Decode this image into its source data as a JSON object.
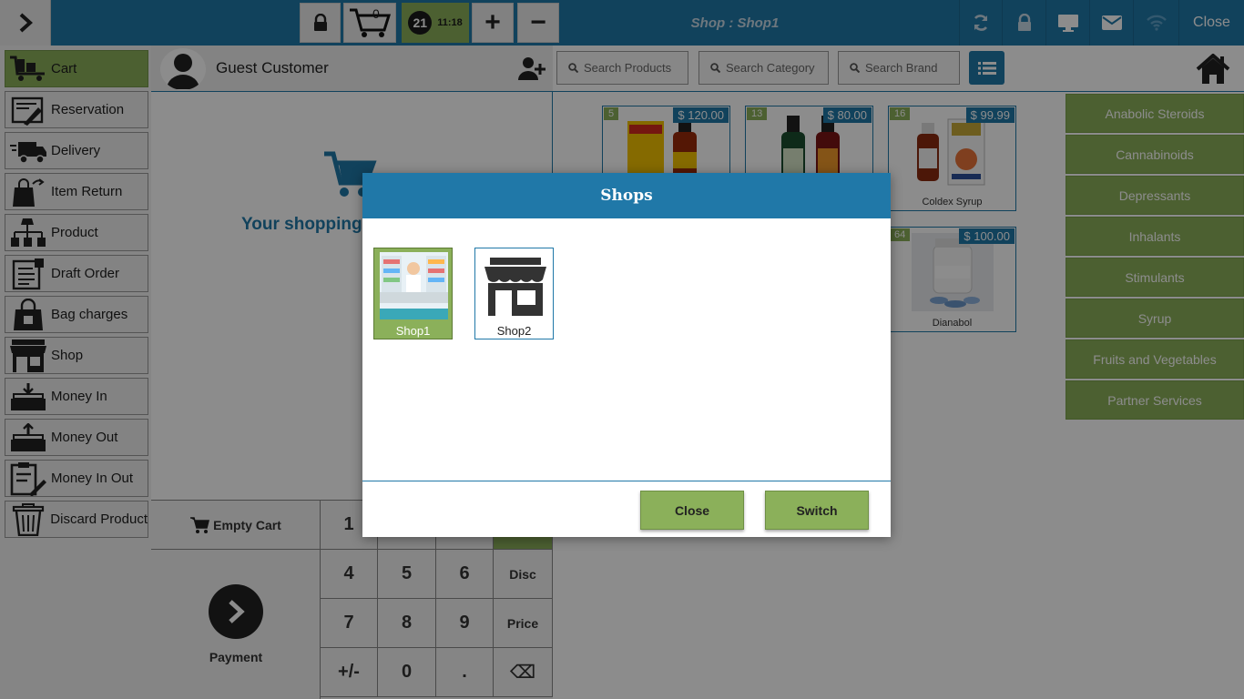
{
  "topbar": {
    "cart_count": "0",
    "held_count": "21",
    "time": "11:18",
    "plus_label": "+",
    "minus_label": "−",
    "shop_title": "Shop : Shop1",
    "close_label": "Close",
    "icons": [
      "chevron-right-icon",
      "lock-icon",
      "cart-icon",
      "refresh-icon",
      "lock-icon",
      "monitor-icon",
      "mail-icon",
      "wifi-icon"
    ]
  },
  "sidebar": {
    "items": [
      {
        "label": "Cart",
        "icon": "cart-pallet-icon",
        "active": true
      },
      {
        "label": "Reservation",
        "icon": "reservation-icon"
      },
      {
        "label": "Delivery",
        "icon": "delivery-truck-icon"
      },
      {
        "label": "Item Return",
        "icon": "return-bag-icon"
      },
      {
        "label": "Product",
        "icon": "product-tree-icon"
      },
      {
        "label": "Draft Order",
        "icon": "draft-order-icon"
      },
      {
        "label": "Bag charges",
        "icon": "bag-icon"
      },
      {
        "label": "Shop",
        "icon": "shop-icon"
      },
      {
        "label": "Money In",
        "icon": "money-in-icon"
      },
      {
        "label": "Money Out",
        "icon": "money-out-icon"
      },
      {
        "label": "Money In Out",
        "icon": "money-in-out-icon"
      },
      {
        "label": "Discard Product",
        "icon": "trash-icon"
      }
    ]
  },
  "customer": {
    "name": "Guest Customer",
    "empty_message": "Your shopping c"
  },
  "keypad": {
    "empty_cart_label": "Empty Cart",
    "payment_label": "Payment",
    "keys": [
      "1",
      "4",
      "5",
      "6",
      "Disc",
      "7",
      "8",
      "9",
      "Price",
      "+/-",
      "0",
      ".",
      "⌫"
    ]
  },
  "search": {
    "products_placeholder": "Search Products",
    "category_placeholder": "Search Category",
    "brand_placeholder": "Search Brand"
  },
  "products": [
    {
      "id": "5",
      "price": "$ 120.00",
      "name": ""
    },
    {
      "id": "13",
      "price": "$ 80.00",
      "name": ""
    },
    {
      "id": "16",
      "price": "$ 99.99",
      "name": "Coldex Syrup"
    },
    {
      "id": "64",
      "price": "$ 100.00",
      "name": "Dianabol"
    }
  ],
  "categories": [
    "Anabolic Steroids",
    "Cannabinoids",
    "Depressants",
    "Inhalants",
    "Stimulants",
    "Syrup",
    "Fruits and Vegetables",
    "Partner Services"
  ],
  "modal": {
    "title": "Shops",
    "shops": [
      {
        "label": "Shop1",
        "selected": true
      },
      {
        "label": "Shop2",
        "selected": false
      }
    ],
    "close_label": "Close",
    "switch_label": "Switch"
  },
  "colors": {
    "primary_blue": "#2078a8",
    "accent_green": "#8bb05a"
  }
}
